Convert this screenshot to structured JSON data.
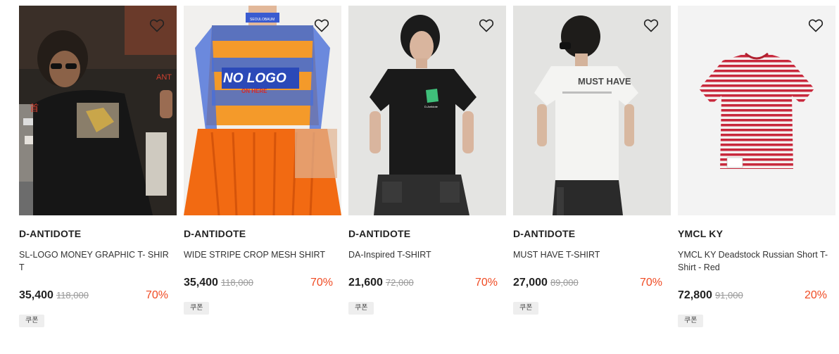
{
  "products": [
    {
      "brand": "D-ANTIDOTE",
      "name": "SL-LOGO MONEY GRAPHIC T- SHIRT",
      "price": "35,400",
      "original_price": "118,000",
      "discount": "70%",
      "coupon": "쿠폰",
      "image_text": [
        "NT",
        "ANT",
        "首"
      ]
    },
    {
      "brand": "D-ANTIDOTE",
      "name": "WIDE STRIPE CROP MESH SHIRT",
      "price": "35,400",
      "original_price": "118,000",
      "discount": "70%",
      "coupon": "쿠폰",
      "image_text": [
        "NO LOGO",
        "ON HERE",
        "SEOULOBAUM"
      ]
    },
    {
      "brand": "D-ANTIDOTE",
      "name": "DA-Inspired T-SHIRT",
      "price": "21,600",
      "original_price": "72,000",
      "discount": "70%",
      "coupon": "쿠폰",
      "image_text": [
        "D-Antidote"
      ]
    },
    {
      "brand": "D-ANTIDOTE",
      "name": "MUST HAVE T-SHIRT",
      "price": "27,000",
      "original_price": "89,000",
      "discount": "70%",
      "coupon": "쿠폰",
      "image_text": [
        "MUST HAVE"
      ]
    },
    {
      "brand": "YMCL KY",
      "name": "YMCL KY Deadstock Russian Short T-Shirt - Red",
      "price": "72,800",
      "original_price": "91,000",
      "discount": "20%",
      "coupon": "쿠폰",
      "image_text": []
    }
  ],
  "icons": {
    "wishlist": "heart-outline-icon"
  },
  "colors": {
    "discount": "#f04b23",
    "coupon_bg": "#eeeeee"
  }
}
